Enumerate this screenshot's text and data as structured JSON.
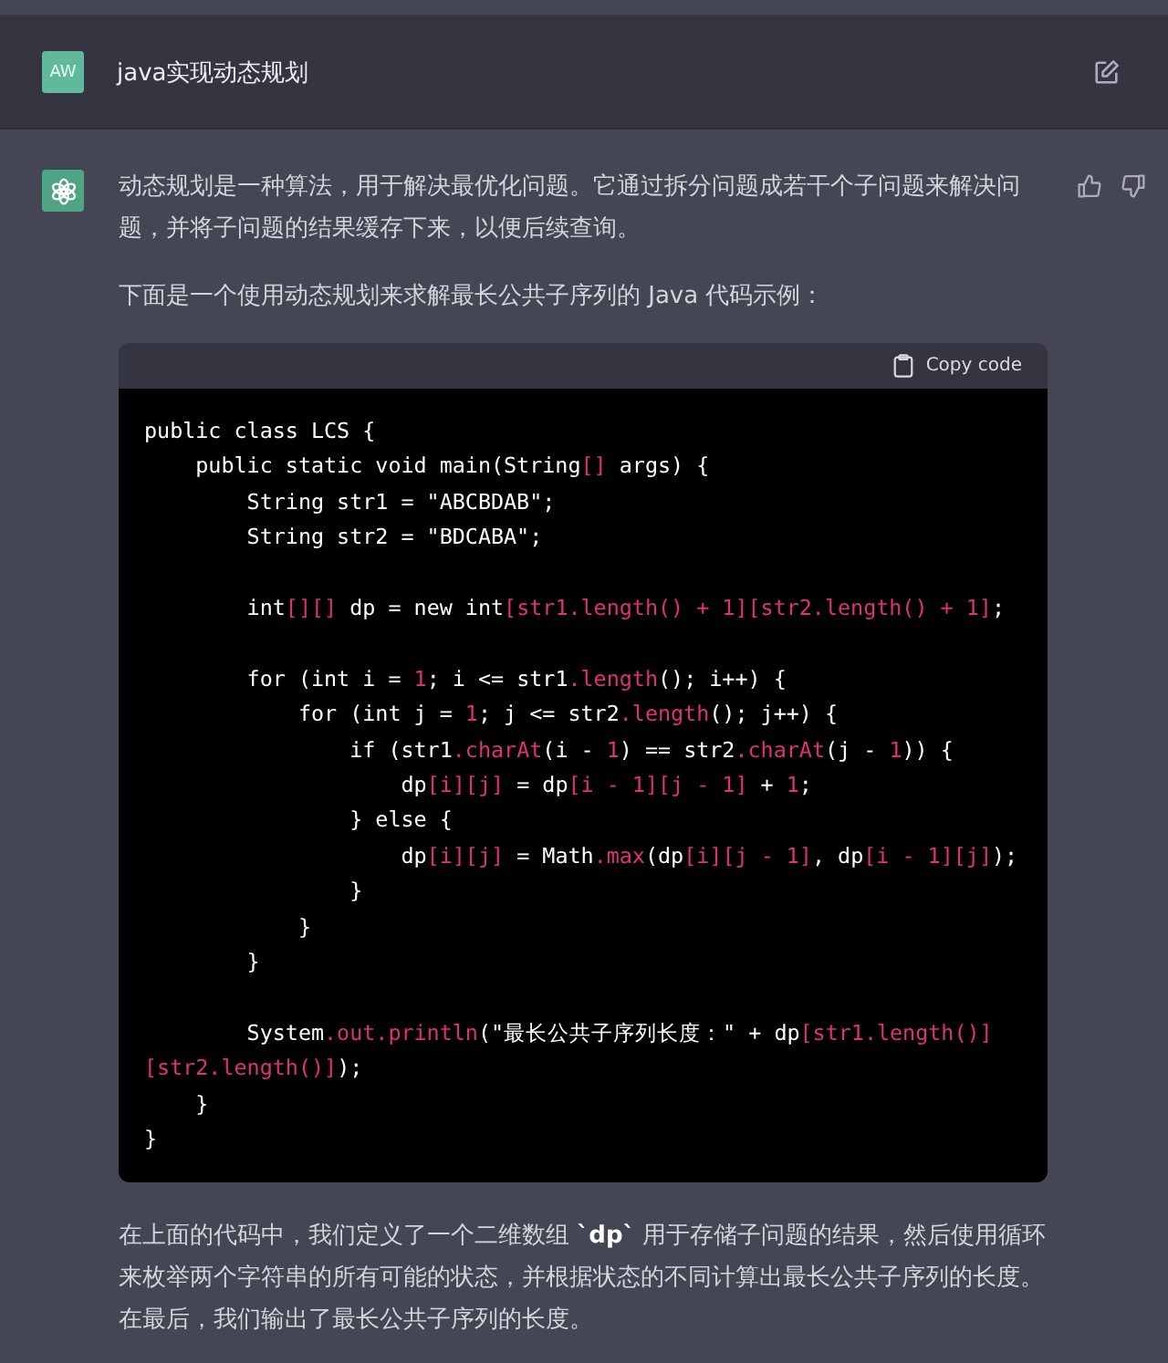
{
  "user_message": {
    "avatar": "AW",
    "text": "java实现动态规划"
  },
  "assistant_message": {
    "intro": [
      "动态规划是一种算法，用于解决最优化问题。它通过拆分问题成若干个子问题来解决问题，并将子问题的结果缓存下来，以便后续查询。",
      "下面是一个使用动态规划来求解最长公共子序列的 Java 代码示例："
    ],
    "code_block": {
      "copy_label": "Copy code",
      "lines": [
        {
          "kind": "code",
          "segments": [
            {
              "text": "public class LCS {",
              "kind": "plain"
            }
          ]
        },
        {
          "kind": "code",
          "segments": [
            {
              "text": "    public static void main(String",
              "kind": "plain"
            },
            {
              "text": "[]",
              "kind": "accent"
            },
            {
              "text": " args) {",
              "kind": "plain"
            }
          ]
        },
        {
          "kind": "code",
          "segments": [
            {
              "text": "        String str1 = \"ABCBDAB\";",
              "kind": "plain"
            }
          ]
        },
        {
          "kind": "code",
          "segments": [
            {
              "text": "        String str2 = \"BDCABA\";",
              "kind": "plain"
            }
          ]
        },
        {
          "kind": "blank"
        },
        {
          "kind": "code",
          "segments": [
            {
              "text": "        int",
              "kind": "plain"
            },
            {
              "text": "[][]",
              "kind": "accent"
            },
            {
              "text": " dp = new int",
              "kind": "plain"
            },
            {
              "text": "[str1.length() + 1][str2.length() + 1]",
              "kind": "accent"
            },
            {
              "text": ";",
              "kind": "plain"
            }
          ]
        },
        {
          "kind": "blank"
        },
        {
          "kind": "code",
          "segments": [
            {
              "text": "        for (int i = ",
              "kind": "plain"
            },
            {
              "text": "1",
              "kind": "accent"
            },
            {
              "text": "; i <= str1",
              "kind": "plain"
            },
            {
              "text": ".length",
              "kind": "accent"
            },
            {
              "text": "(); i++) {",
              "kind": "plain"
            }
          ]
        },
        {
          "kind": "code",
          "segments": [
            {
              "text": "            for (int j = ",
              "kind": "plain"
            },
            {
              "text": "1",
              "kind": "accent"
            },
            {
              "text": "; j <= str2",
              "kind": "plain"
            },
            {
              "text": ".length",
              "kind": "accent"
            },
            {
              "text": "(); j++) {",
              "kind": "plain"
            }
          ]
        },
        {
          "kind": "code",
          "segments": [
            {
              "text": "                if (str1",
              "kind": "plain"
            },
            {
              "text": ".charAt",
              "kind": "accent"
            },
            {
              "text": "(i - ",
              "kind": "plain"
            },
            {
              "text": "1",
              "kind": "accent"
            },
            {
              "text": ") == str2",
              "kind": "plain"
            },
            {
              "text": ".charAt",
              "kind": "accent"
            },
            {
              "text": "(j - ",
              "kind": "plain"
            },
            {
              "text": "1",
              "kind": "accent"
            },
            {
              "text": ")) {",
              "kind": "plain"
            }
          ]
        },
        {
          "kind": "code",
          "segments": [
            {
              "text": "                    dp",
              "kind": "plain"
            },
            {
              "text": "[i][j]",
              "kind": "accent"
            },
            {
              "text": " = dp",
              "kind": "plain"
            },
            {
              "text": "[i - 1][j - 1]",
              "kind": "accent"
            },
            {
              "text": " + ",
              "kind": "plain"
            },
            {
              "text": "1",
              "kind": "accent"
            },
            {
              "text": ";",
              "kind": "plain"
            }
          ]
        },
        {
          "kind": "code",
          "segments": [
            {
              "text": "                } else {",
              "kind": "plain"
            }
          ]
        },
        {
          "kind": "code",
          "segments": [
            {
              "text": "                    dp",
              "kind": "plain"
            },
            {
              "text": "[i][j]",
              "kind": "accent"
            },
            {
              "text": " = Math",
              "kind": "plain"
            },
            {
              "text": ".max",
              "kind": "accent"
            },
            {
              "text": "(dp",
              "kind": "plain"
            },
            {
              "text": "[i][j - 1]",
              "kind": "accent"
            },
            {
              "text": ", dp",
              "kind": "plain"
            },
            {
              "text": "[i - 1][j]",
              "kind": "accent"
            },
            {
              "text": ");",
              "kind": "plain"
            }
          ]
        },
        {
          "kind": "code",
          "segments": [
            {
              "text": "                }",
              "kind": "plain"
            }
          ]
        },
        {
          "kind": "code",
          "segments": [
            {
              "text": "            }",
              "kind": "plain"
            }
          ]
        },
        {
          "kind": "code",
          "segments": [
            {
              "text": "        }",
              "kind": "plain"
            }
          ]
        },
        {
          "kind": "blank"
        },
        {
          "kind": "code",
          "segments": [
            {
              "text": "        System",
              "kind": "plain"
            },
            {
              "text": ".out.println",
              "kind": "accent"
            },
            {
              "text": "(\"最长公共子序列长度：\" + dp",
              "kind": "plain"
            },
            {
              "text": "[str1.length()]",
              "kind": "accent"
            }
          ]
        },
        {
          "kind": "code",
          "segments": [
            {
              "text": "[str2.length()]",
              "kind": "accent"
            },
            {
              "text": ");",
              "kind": "plain"
            }
          ]
        },
        {
          "kind": "code",
          "segments": [
            {
              "text": "    }",
              "kind": "plain"
            }
          ]
        },
        {
          "kind": "code",
          "segments": [
            {
              "text": "}",
              "kind": "plain"
            }
          ]
        }
      ]
    },
    "outro": "在上面的代码中，我们定义了一个二维数组 **`dp`** 用于存储子问题的结果，然后使用循环来枚举两个字符串的所有可能的状态，并根据状态的不同计算出最长公共子序列的长度。在最后，我们输出了最长公共子序列的长度。"
  }
}
